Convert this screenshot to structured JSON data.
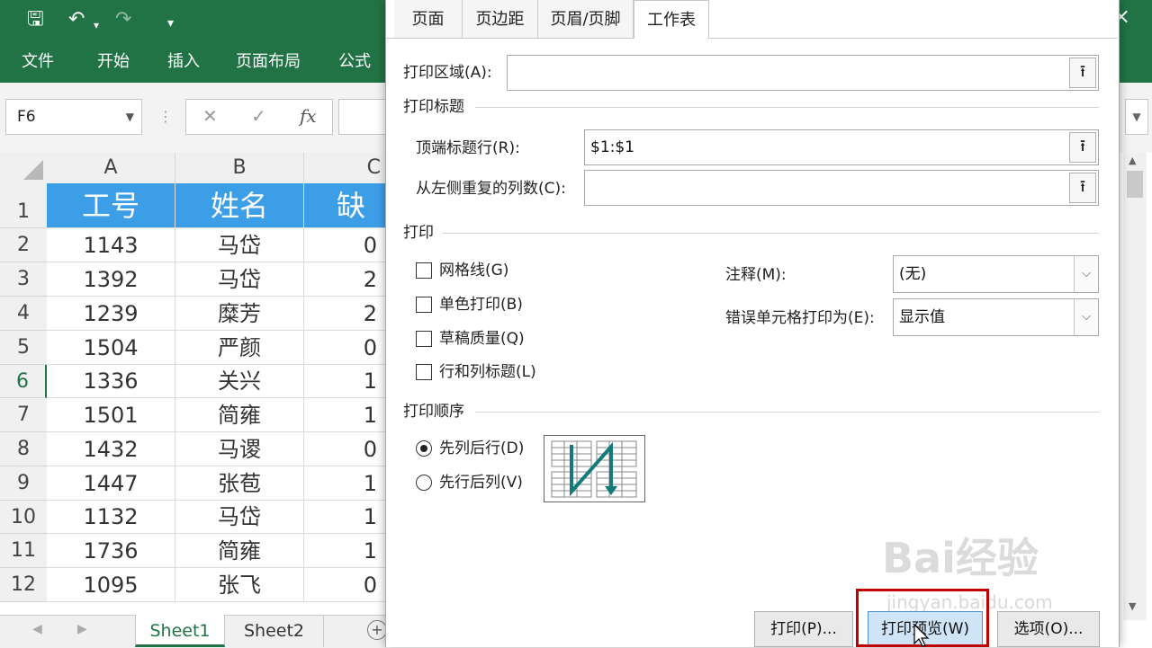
{
  "ribbon": {
    "tabs": [
      "文件",
      "开始",
      "插入",
      "页面布局",
      "公式"
    ],
    "close": "×",
    "undo": "↶",
    "redo": "↷",
    "save": "🖫",
    "customize": "▾"
  },
  "formula_bar": {
    "name_box": "F6",
    "cancel": "✕",
    "enter": "✓",
    "fx": "fx"
  },
  "grid": {
    "columns": [
      "A",
      "B",
      "C"
    ],
    "header_row": [
      "工号",
      "姓名",
      "缺勤"
    ],
    "rows": [
      {
        "n": "1"
      },
      {
        "n": "2",
        "a": "1143",
        "b": "马岱",
        "c": "0"
      },
      {
        "n": "3",
        "a": "1392",
        "b": "马岱",
        "c": "2"
      },
      {
        "n": "4",
        "a": "1239",
        "b": "糜芳",
        "c": "2"
      },
      {
        "n": "5",
        "a": "1504",
        "b": "严颜",
        "c": "0"
      },
      {
        "n": "6",
        "a": "1336",
        "b": "关兴",
        "c": "1"
      },
      {
        "n": "7",
        "a": "1501",
        "b": "简雍",
        "c": "1"
      },
      {
        "n": "8",
        "a": "1432",
        "b": "马谡",
        "c": "0"
      },
      {
        "n": "9",
        "a": "1447",
        "b": "张苞",
        "c": "1"
      },
      {
        "n": "10",
        "a": "1132",
        "b": "马岱",
        "c": "1"
      },
      {
        "n": "11",
        "a": "1736",
        "b": "简雍",
        "c": "1"
      },
      {
        "n": "12",
        "a": "1095",
        "b": "张飞",
        "c": "0"
      }
    ]
  },
  "sheet_tabs": [
    "Sheet1",
    "Sheet2"
  ],
  "dialog": {
    "tabs": [
      "页面",
      "页边距",
      "页眉/页脚",
      "工作表"
    ],
    "print_area_label": "打印区域(A):",
    "print_area_value": "",
    "print_titles_group": "打印标题",
    "rows_repeat_label": "顶端标题行(R):",
    "rows_repeat_value": "$1:$1",
    "cols_repeat_label": "从左侧重复的列数(C):",
    "cols_repeat_value": "",
    "print_group": "打印",
    "gridlines": "网格线(G)",
    "black_white": "单色打印(B)",
    "draft": "草稿质量(Q)",
    "row_col_headings": "行和列标题(L)",
    "comments_label": "注释(M):",
    "comments_value": "(无)",
    "errors_label": "错误单元格打印为(E):",
    "errors_value": "显示值",
    "order_group": "打印顺序",
    "down_then_over": "先列后行(D)",
    "over_then_down": "先行后列(V)",
    "pick_icon": "⭱",
    "buttons": {
      "print": "打印(P)...",
      "preview": "打印预览(W)",
      "options": "选项(O)..."
    }
  },
  "watermark": {
    "brand": "Bai经验",
    "url": "jingyan.baidu.com"
  },
  "colors": {
    "ribbon": "#217346",
    "header_fill": "#3d9ee8",
    "highlight": "#c00000"
  }
}
